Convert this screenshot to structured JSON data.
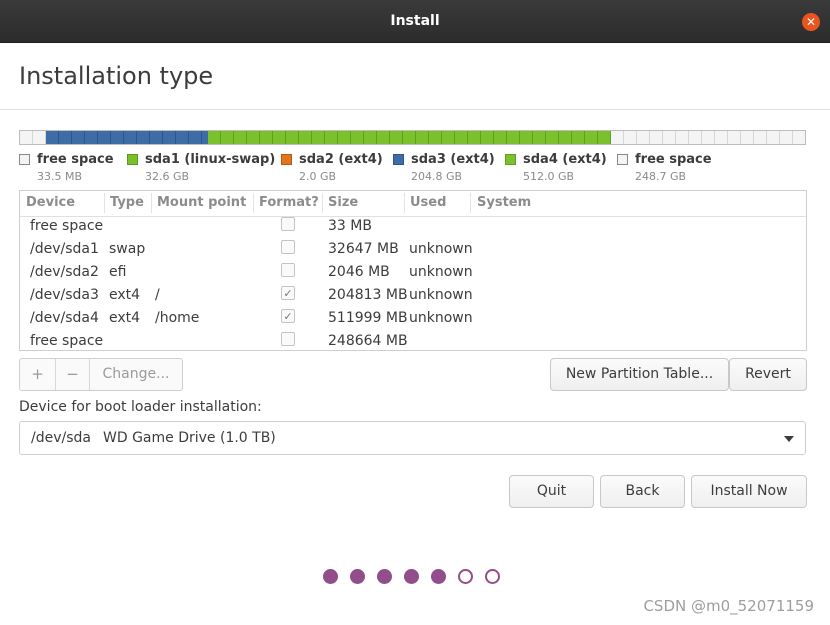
{
  "window": {
    "title": "Install",
    "close": "✕"
  },
  "page": {
    "title": "Installation type"
  },
  "partition_bar": [
    {
      "type": "free",
      "fraction": 0.0333
    },
    {
      "type": "swap",
      "fraction": 0.2133
    },
    {
      "type": "efi",
      "fraction": 0.0013
    },
    {
      "type": "ext3",
      "fraction": 0.0
    },
    {
      "type": "ext4",
      "fraction": 0.5173
    },
    {
      "type": "free",
      "fraction": 0.2548
    }
  ],
  "legend": [
    {
      "name": "free space",
      "size": "33.5 MB",
      "color": "#f4f4f4"
    },
    {
      "name": "sda1 (linux-swap)",
      "size": "32.6 GB",
      "color": "#7bbf2a"
    },
    {
      "name": "sda2 (ext4)",
      "size": "2.0 GB",
      "color": "#e5731c"
    },
    {
      "name": "sda3 (ext4)",
      "size": "204.8 GB",
      "color": "#3e6ca6"
    },
    {
      "name": "sda4 (ext4)",
      "size": "512.0 GB",
      "color": "#7bc12d"
    },
    {
      "name": "free space",
      "size": "248.7 GB",
      "color": "#f4f4f4"
    }
  ],
  "table": {
    "headers": [
      "Device",
      "Type",
      "Mount point",
      "Format?",
      "Size",
      "Used",
      "System"
    ],
    "rows": [
      {
        "device": "free space",
        "type": "",
        "mount": "",
        "format": false,
        "size": "33 MB",
        "used": ""
      },
      {
        "device": "/dev/sda1",
        "type": "swap",
        "mount": "",
        "format": false,
        "size": "32647 MB",
        "used": "unknown"
      },
      {
        "device": "/dev/sda2",
        "type": "efi",
        "mount": "",
        "format": false,
        "size": "2046 MB",
        "used": "unknown"
      },
      {
        "device": "/dev/sda3",
        "type": "ext4",
        "mount": "/",
        "format": true,
        "size": "204813 MB",
        "used": "unknown"
      },
      {
        "device": "/dev/sda4",
        "type": "ext4",
        "mount": "/home",
        "format": true,
        "size": "511999 MB",
        "used": "unknown"
      },
      {
        "device": "free space",
        "type": "",
        "mount": "",
        "format": false,
        "size": "248664 MB",
        "used": ""
      }
    ]
  },
  "toolbar": {
    "add": "+",
    "remove": "−",
    "change": "Change...",
    "new_table": "New Partition Table...",
    "revert": "Revert"
  },
  "boot": {
    "label": "Device for boot loader installation:",
    "device": "/dev/sda",
    "name": "WD Game Drive (1.0 TB)"
  },
  "buttons": {
    "quit": "Quit",
    "back": "Back",
    "install": "Install Now"
  },
  "progress": {
    "total_steps": 7,
    "completed_steps": 5
  },
  "watermark": "CSDN @m0_52071159"
}
